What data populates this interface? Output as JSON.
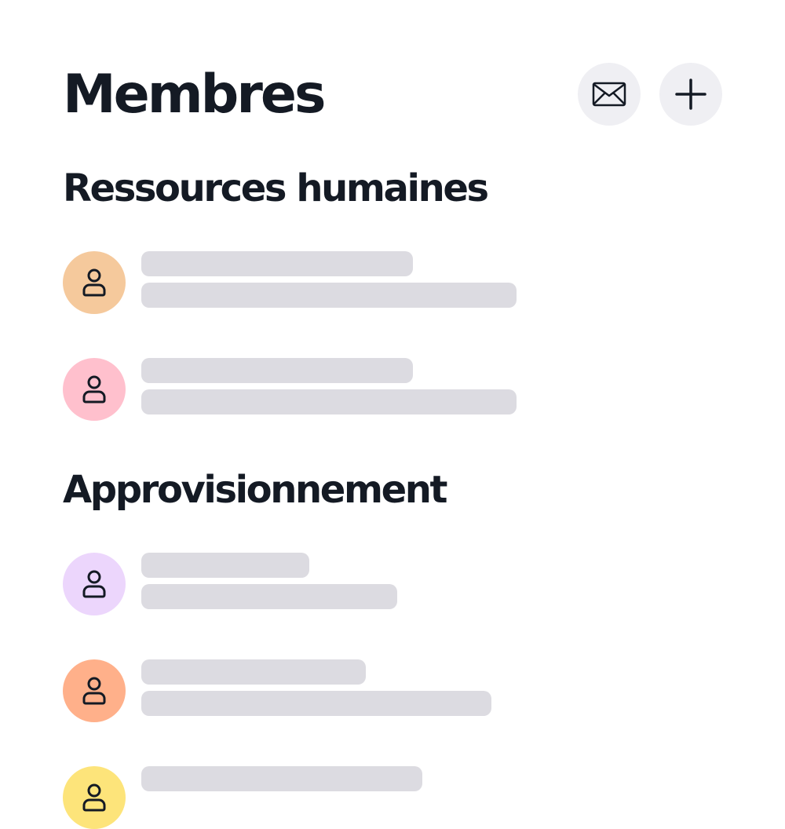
{
  "header": {
    "title": "Membres",
    "mail_icon": "envelope-icon",
    "add_icon": "plus-icon"
  },
  "sections": [
    {
      "title": "Ressources humaines",
      "members": [
        {
          "avatar_color": "#f5c99c",
          "icon": "user-icon"
        },
        {
          "avatar_color": "#ffc0cd",
          "icon": "user-icon"
        }
      ]
    },
    {
      "title": "Approvisionnement",
      "members": [
        {
          "avatar_color": "#ecd6fc",
          "icon": "user-icon"
        },
        {
          "avatar_color": "#ffb08a",
          "icon": "user-icon"
        },
        {
          "avatar_color": "#fde47a",
          "icon": "user-icon"
        }
      ]
    }
  ],
  "colors": {
    "text": "#141a24",
    "button_bg": "#efeff3",
    "skeleton": "#dcdbe1"
  }
}
